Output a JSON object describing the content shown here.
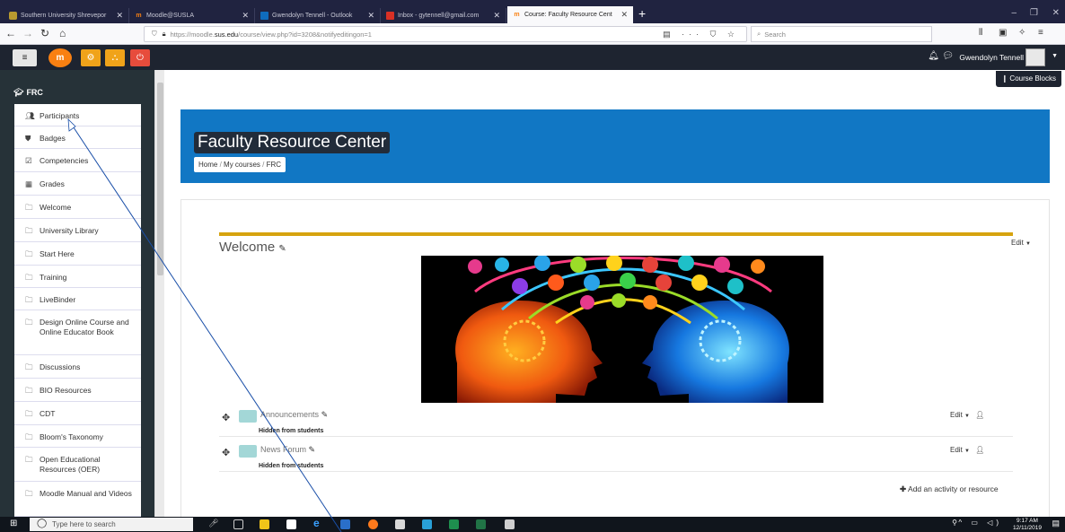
{
  "browser": {
    "tabs": [
      {
        "title": "Southern University Shrevepor",
        "active": false,
        "favicon_color": "#b89a2f"
      },
      {
        "title": "Moodle@SUSLA",
        "active": false,
        "favicon_color": "#f98012"
      },
      {
        "title": "Gwendolyn Tennell - Outlook",
        "active": false,
        "favicon_color": "#0f6cbd"
      },
      {
        "title": "Inbox - gytennell@gmail.com",
        "active": false,
        "favicon_color": "#d93025"
      },
      {
        "title": "Course: Faculty Resource Cent",
        "active": true,
        "favicon_color": "#f98012"
      }
    ],
    "url_prefix": "https://moodle.",
    "url_domain": "sus.edu",
    "url_path": "/course/view.php?id=3208&notifyeditingon=1",
    "search_placeholder": "Search"
  },
  "header": {
    "user_name": "Gwendolyn Tennell",
    "colors": {
      "bg": "#1e2430",
      "orange": "#f98012",
      "red": "#e74c3c"
    }
  },
  "sidebar": {
    "course": "FRC",
    "items": [
      {
        "label": "Participants",
        "icon": "users-icon"
      },
      {
        "label": "Badges",
        "icon": "shield-icon"
      },
      {
        "label": "Competencies",
        "icon": "checkbox-icon"
      },
      {
        "label": "Grades",
        "icon": "table-icon"
      },
      {
        "label": "Welcome",
        "icon": "folder-icon"
      },
      {
        "label": "University Library",
        "icon": "folder-icon"
      },
      {
        "label": "Start Here",
        "icon": "folder-icon"
      },
      {
        "label": "Training",
        "icon": "folder-icon"
      },
      {
        "label": "LiveBinder",
        "icon": "folder-icon"
      },
      {
        "label": "Design Online Course and Online Educator Book",
        "icon": "folder-icon"
      },
      {
        "label": "Discussions",
        "icon": "folder-icon"
      },
      {
        "label": "BIO Resources",
        "icon": "folder-icon"
      },
      {
        "label": "CDT",
        "icon": "folder-icon"
      },
      {
        "label": "Bloom's Taxonomy",
        "icon": "folder-icon"
      },
      {
        "label": "Open Educational Resources (OER)",
        "icon": "folder-icon"
      },
      {
        "label": "Moodle Manual and Videos",
        "icon": "folder-icon"
      }
    ]
  },
  "main": {
    "course_blocks": "Course Blocks",
    "course_title": "Faculty Resource Center",
    "breadcrumb": [
      "Home",
      "My courses",
      "FRC"
    ],
    "section_title": "Welcome",
    "section_edit": "Edit",
    "activities": [
      {
        "name": "Announcements",
        "status": "Hidden from students",
        "edit": "Edit"
      },
      {
        "name": "News Forum",
        "status": "Hidden from students",
        "edit": "Edit"
      }
    ],
    "add_activity": "Add an activity or resource",
    "accent_color": "#1177c4",
    "section_bar_color": "#d6a30f"
  },
  "taskbar": {
    "search_placeholder": "Type here to search",
    "time": "9:17 AM",
    "date": "12/11/2019"
  }
}
